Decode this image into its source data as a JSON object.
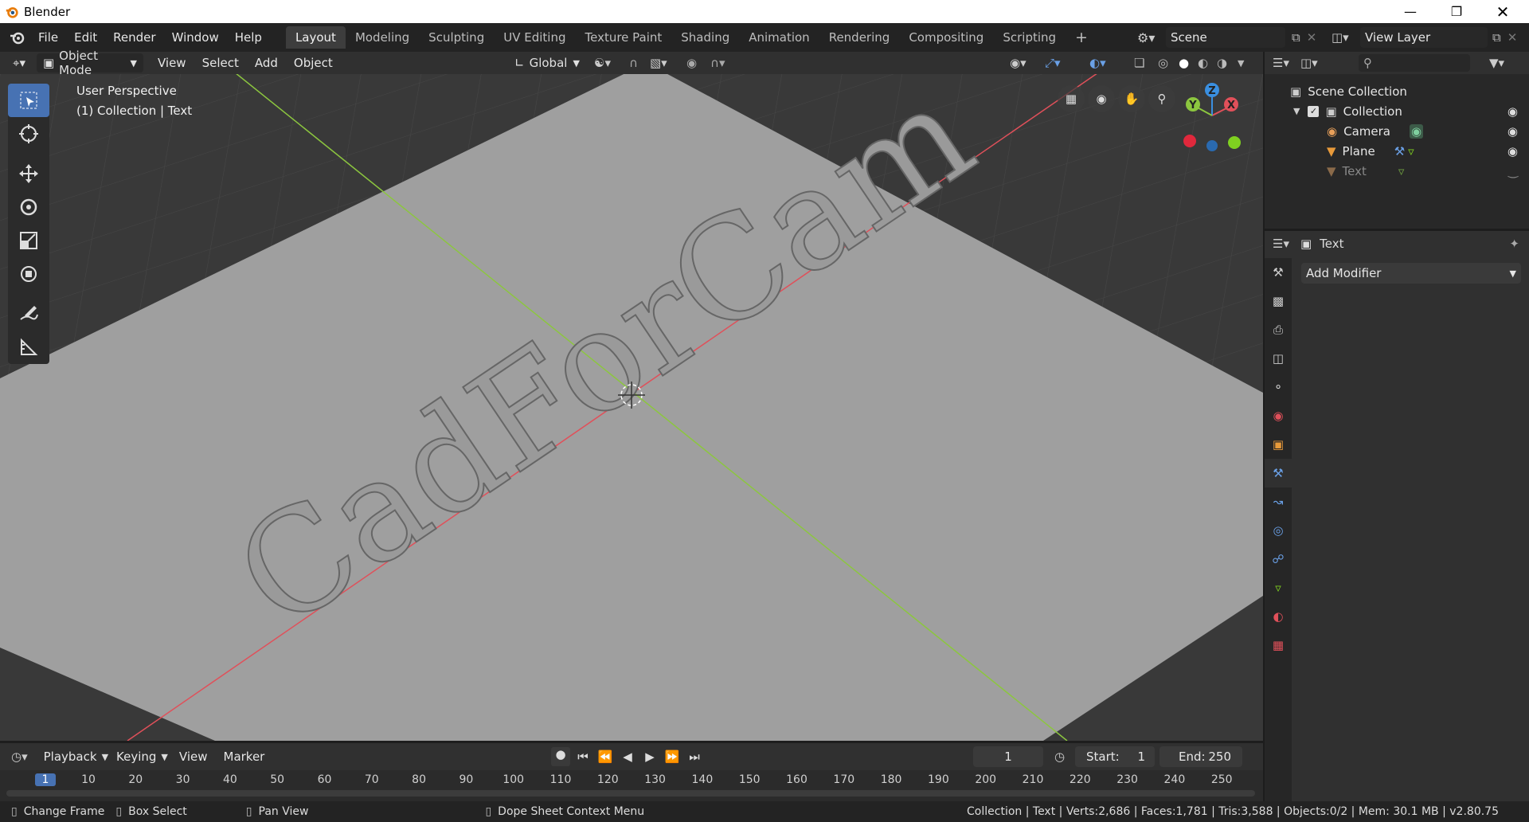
{
  "window": {
    "title": "Blender"
  },
  "menu": [
    "File",
    "Edit",
    "Render",
    "Window",
    "Help"
  ],
  "workspaces": [
    "Layout",
    "Modeling",
    "Sculpting",
    "UV Editing",
    "Texture Paint",
    "Shading",
    "Animation",
    "Rendering",
    "Compositing",
    "Scripting"
  ],
  "active_workspace": "Layout",
  "add_workspace": "+",
  "scene": {
    "label": "Scene"
  },
  "view_layer": {
    "label": "View Layer"
  },
  "viewport_header": {
    "mode": "Object Mode",
    "menus": [
      "View",
      "Select",
      "Add",
      "Object"
    ],
    "transform_orientation": "Global"
  },
  "viewport": {
    "perspective": "User Perspective",
    "context": "(1) Collection | Text",
    "scene_text": "CadForCam",
    "gizmo_axes": [
      "X",
      "Y",
      "Z"
    ]
  },
  "outliner": {
    "search_placeholder": "",
    "root": "Scene Collection",
    "collection": "Collection",
    "items": [
      {
        "name": "Camera",
        "type": "camera"
      },
      {
        "name": "Plane",
        "type": "mesh"
      },
      {
        "name": "Text",
        "type": "text"
      }
    ]
  },
  "properties": {
    "object_name": "Text",
    "add_modifier": "Add Modifier"
  },
  "timeline": {
    "menus": [
      "Playback",
      "Keying",
      "View",
      "Marker"
    ],
    "current_frame": "1",
    "start_label": "Start:",
    "start": "1",
    "end_label": "End:",
    "end": "250",
    "ticks": [
      "1",
      "10",
      "20",
      "30",
      "40",
      "50",
      "60",
      "70",
      "80",
      "90",
      "100",
      "110",
      "120",
      "130",
      "140",
      "150",
      "160",
      "170",
      "180",
      "190",
      "200",
      "210",
      "220",
      "230",
      "240",
      "250"
    ]
  },
  "statusbar": {
    "change_frame": "Change Frame",
    "box_select": "Box Select",
    "pan_view": "Pan View",
    "context_menu": "Dope Sheet Context Menu",
    "stats": "Collection | Text | Verts:2,686 | Faces:1,781 | Tris:3,588 | Objects:0/2 | Mem: 30.1 MB | v2.80.75"
  },
  "colors": {
    "accent": "#4772b3",
    "x_axis": "#e0505a",
    "y_axis": "#8cc63f",
    "z_axis": "#3a8fe0",
    "plane": "#a0a0a0"
  }
}
